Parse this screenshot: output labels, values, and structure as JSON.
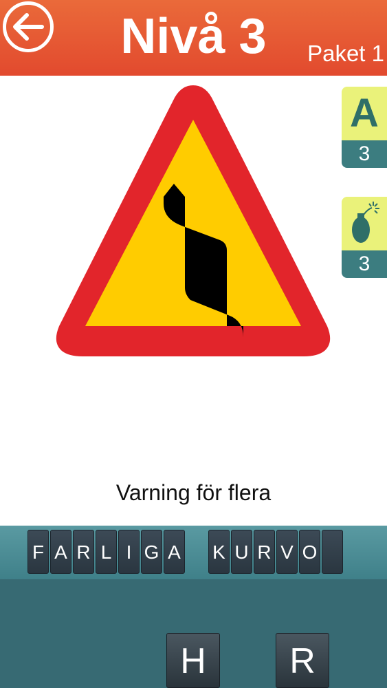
{
  "header": {
    "title": "Nivå 3",
    "pack": "Paket 1",
    "back_icon": "back-arrow-icon"
  },
  "hints": {
    "reveal_letter": {
      "glyph": "A",
      "count": "3"
    },
    "bomb": {
      "icon": "bomb-icon",
      "count": "3"
    }
  },
  "sign": {
    "icon": "warning-multiple-curves-sign",
    "colors": {
      "border": "#e2252b",
      "fill": "#ffcc00",
      "symbol": "#000000"
    }
  },
  "clue": "Varning för flera",
  "answer": {
    "word1": [
      "F",
      "A",
      "R",
      "L",
      "I",
      "G",
      "A"
    ],
    "word2": [
      "K",
      "U",
      "R",
      "V",
      "O",
      ""
    ]
  },
  "letter_tray": [
    "H",
    "R"
  ],
  "colors": {
    "header": "#e5522f",
    "hint_top": "#eaf27a",
    "hint_bottom": "#3c7d80",
    "answer_bar": "#4d8e96",
    "tray": "#376a73"
  }
}
